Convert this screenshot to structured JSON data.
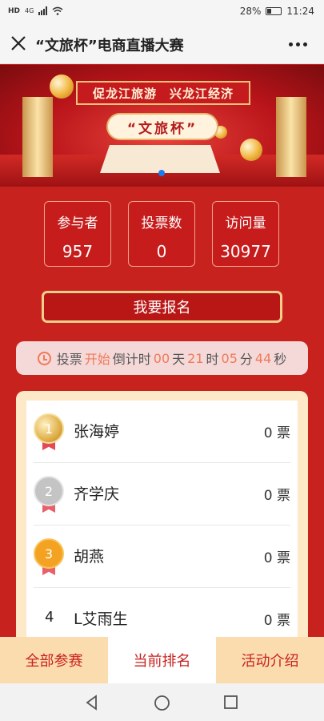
{
  "status_bar": {
    "network": "HD",
    "signal_label": "4G",
    "battery": "28%",
    "time": "11:24"
  },
  "nav": {
    "title": "“文旅杯”电商直播大赛",
    "close_icon": "close-icon",
    "more_icon": "more-icon"
  },
  "banner": {
    "slogan": "促龙江旅游　兴龙江经济",
    "cup_title": "“文旅杯”"
  },
  "stats": [
    {
      "label": "参与者",
      "value": "957"
    },
    {
      "label": "投票数",
      "value": "0"
    },
    {
      "label": "访问量",
      "value": "30977"
    }
  ],
  "signup_label": "我要报名",
  "countdown": {
    "prefix": "投票",
    "status": "开始",
    "mid": "倒计时",
    "days": "00",
    "days_unit": "天",
    "hours": "21",
    "hours_unit": "时",
    "minutes": "05",
    "minutes_unit": "分",
    "seconds": "44",
    "seconds_unit": "秒"
  },
  "ranking": [
    {
      "rank": "1",
      "name": "张海婷",
      "votes": "0 票",
      "medal": "gold"
    },
    {
      "rank": "2",
      "name": "齐学庆",
      "votes": "0 票",
      "medal": "silver"
    },
    {
      "rank": "3",
      "name": "胡燕",
      "votes": "0 票",
      "medal": "bronze"
    },
    {
      "rank": "4",
      "name": "L艾雨生",
      "votes": "0 票",
      "medal": ""
    }
  ],
  "tabs": [
    {
      "label": "全部参赛"
    },
    {
      "label": "当前排名",
      "active": true
    },
    {
      "label": "活动介绍"
    }
  ],
  "colors": {
    "primary": "#c8221f",
    "accent": "#f07a5a",
    "tab_bg": "#fbdcae",
    "gold": "#e0b04a",
    "silver": "#c4c4c4",
    "bronze": "#f3a321"
  }
}
